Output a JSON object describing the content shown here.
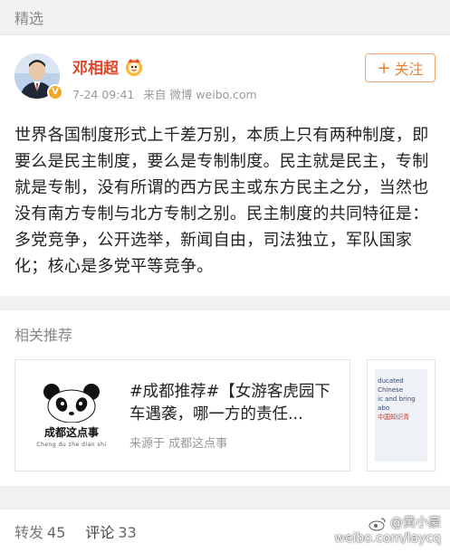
{
  "section": {
    "label": "精选"
  },
  "post": {
    "username": "邓相超",
    "timestamp": "7-24 09:41",
    "source": "来自 微博 weibo.com",
    "follow_label": "关注",
    "text": "世界各国制度形式上千差万别，本质上只有两种制度，即要么是民主制度，要么是专制制度。民主就是民主，专制就是专制，没有所谓的西方民主或东方民主之分，当然也没有南方专制与北方专制之别。民主制度的共同特征是：多党竞争，公开选举，新闻自由，司法独立，军队国家化；核心是多党平等竞争。"
  },
  "recommend": {
    "title": "相关推荐",
    "card": {
      "brand": "成都这点事",
      "brand_sub": "Cheng du zhe dian shi",
      "headline": "#成都推荐#【女游客虎园下车遇袭，哪一方的责任...",
      "source": "来源于 成都这点事"
    },
    "card2": {
      "lines": [
        "ducated Chinese",
        "ic and bring abo",
        "中国知识青"
      ]
    }
  },
  "footer": {
    "repost_label": "转发",
    "repost_count": "45",
    "comment_label": "评论",
    "comment_count": "33"
  },
  "watermark": {
    "line1": "@黄小豪",
    "line2": "weibo.com/laycq"
  },
  "colors": {
    "name": "#e2472b",
    "follow": "#ef7f32",
    "badge": "#f6a623"
  },
  "icons": {
    "verified": "verified-badge-icon",
    "vip": "vip-crown-icon",
    "panda": "panda-logo-icon",
    "weibo": "weibo-logo-icon"
  }
}
